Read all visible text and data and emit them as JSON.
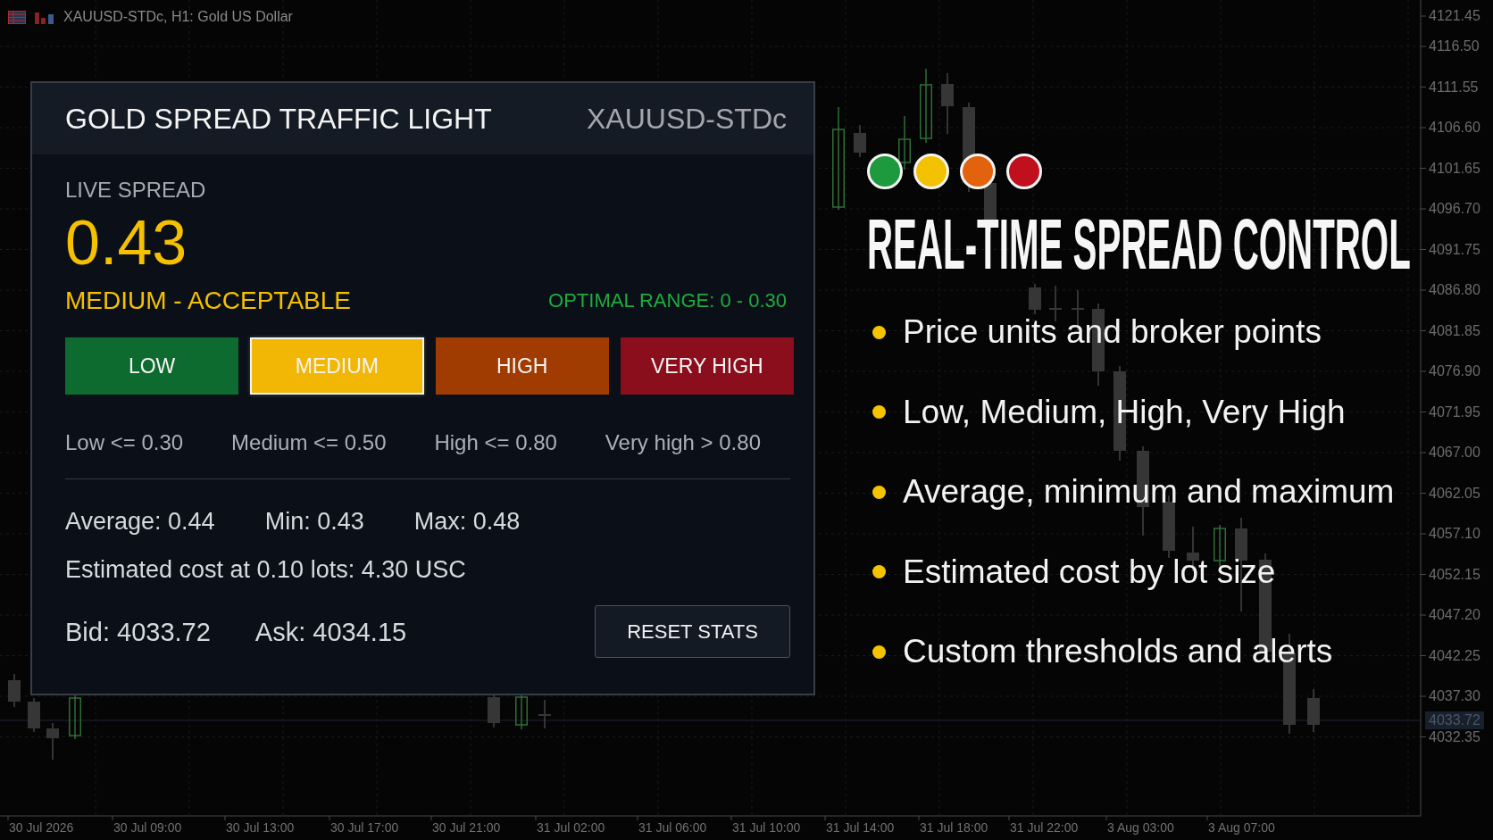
{
  "chart_header": {
    "title": "XAUUSD-STDc, H1: Gold US Dollar"
  },
  "price_axis": {
    "labels": [
      "4121.45",
      "4116.50",
      "4111.55",
      "4106.60",
      "4101.65",
      "4096.70",
      "4091.75",
      "4086.80",
      "4081.85",
      "4076.90",
      "4071.95",
      "4067.00",
      "4062.05",
      "4057.10",
      "4052.15",
      "4047.20",
      "4042.25",
      "4037.30",
      "4032.35"
    ],
    "current_price": "4033.72"
  },
  "time_axis": {
    "labels": [
      "30 Jul 2026",
      "30 Jul 09:00",
      "30 Jul 13:00",
      "30 Jul 17:00",
      "30 Jul 21:00",
      "31 Jul 02:00",
      "31 Jul 06:00",
      "31 Jul 10:00",
      "31 Jul 14:00",
      "31 Jul 18:00",
      "31 Jul 22:00",
      "3 Aug 03:00",
      "3 Aug 07:00"
    ]
  },
  "panel": {
    "title": "GOLD SPREAD TRAFFIC LIGHT",
    "symbol": "XAUUSD-STDc",
    "live_label": "LIVE SPREAD",
    "spread_value": "0.43",
    "status": "MEDIUM - ACCEPTABLE",
    "optimal_range": "OPTIMAL RANGE: 0 - 0.30",
    "levels": [
      {
        "label": "LOW",
        "color": "#0e6b2f",
        "selected": false
      },
      {
        "label": "MEDIUM",
        "color": "#f2b705",
        "selected": true
      },
      {
        "label": "HIGH",
        "color": "#a03b02",
        "selected": false
      },
      {
        "label": "VERY HIGH",
        "color": "#8a0e1b",
        "selected": false
      }
    ],
    "thresholds": [
      "Low <= 0.30",
      "Medium <= 0.50",
      "High <= 0.80",
      "Very high > 0.80"
    ],
    "stats": [
      "Average: 0.44",
      "Min: 0.43",
      "Max: 0.48"
    ],
    "estimated_cost": "Estimated cost at 0.10 lots: 4.30 USC",
    "quotes": [
      "Bid: 4033.72",
      "Ask: 4034.15"
    ],
    "reset_button": "RESET STATS"
  },
  "feature": {
    "lights": [
      {
        "color": "#1c9a3d"
      },
      {
        "color": "#f2c200"
      },
      {
        "color": "#e2620e"
      },
      {
        "color": "#c0101e"
      }
    ],
    "headline": "REAL-TIME SPREAD CONTROL",
    "bullets": [
      "Price units and broker points",
      "Low, Medium, High, Very High",
      "Average, minimum and maximum",
      "Estimated cost by lot size",
      "Custom thresholds and alerts"
    ]
  }
}
